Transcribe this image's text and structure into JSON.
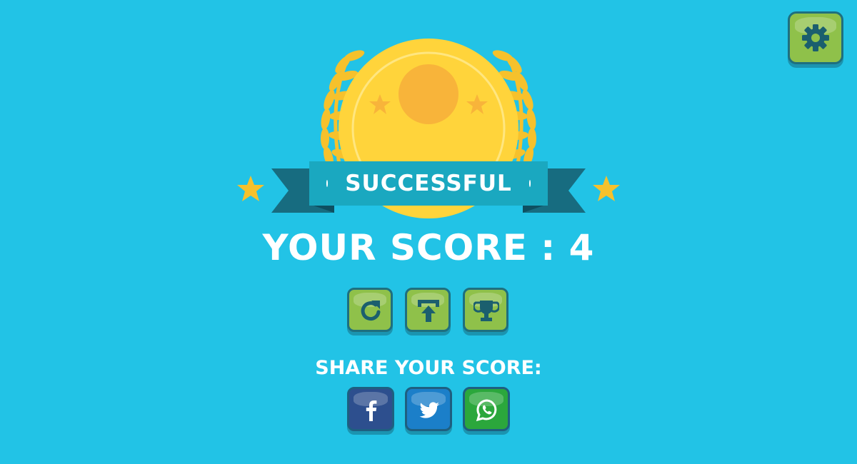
{
  "result": {
    "banner_text": "SUCCESSFUL",
    "score_text": "YOUR SCORE : 4"
  },
  "actions": {
    "replay_icon": "replay-icon",
    "upload_icon": "upload-icon",
    "leaderboard_icon": "trophy-icon"
  },
  "share": {
    "label": "SHARE YOUR SCORE:",
    "networks": [
      "facebook",
      "twitter",
      "whatsapp"
    ]
  },
  "settings": {
    "icon": "gear-icon"
  },
  "colors": {
    "background": "#22c3e6",
    "button_green": "#8fc14a",
    "banner_teal": "#1aa8c0",
    "banner_dark": "#176c80",
    "coin_yellow": "#ffd43b",
    "coin_orange": "#f8b43a",
    "facebook": "#2d4f8e",
    "twitter": "#1b7fc9",
    "whatsapp": "#2ba73c",
    "icon_dark": "#1b5f6e"
  }
}
